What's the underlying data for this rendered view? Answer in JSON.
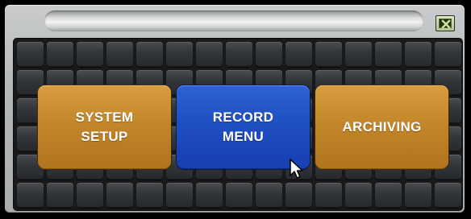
{
  "window": {
    "title": "",
    "close_icon": "close-x-icon"
  },
  "menu": {
    "buttons": [
      {
        "label": "SYSTEM\nSETUP",
        "color": "#c4862a",
        "state": "normal"
      },
      {
        "label": "RECORD\nMENU",
        "color": "#1f4fc3",
        "state": "selected"
      },
      {
        "label": "ARCHIVING",
        "color": "#c4862a",
        "state": "normal"
      }
    ]
  },
  "grid": {
    "columns": 15,
    "rows": 6
  },
  "pointer": {
    "icon": "mouse-cursor-icon"
  }
}
